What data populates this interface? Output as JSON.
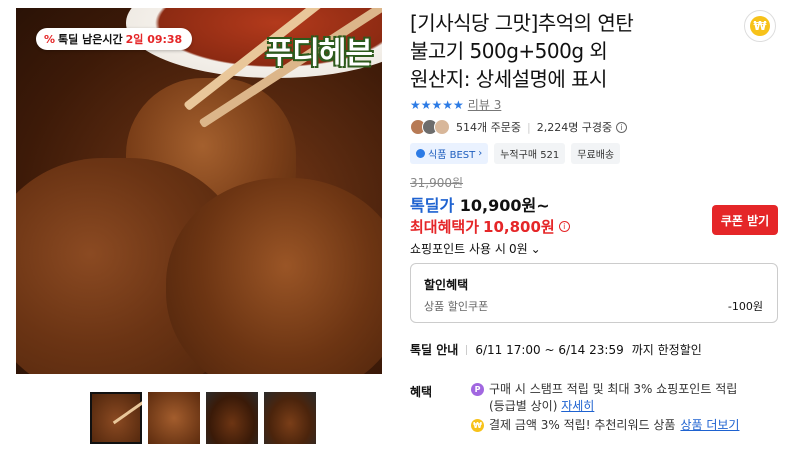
{
  "image": {
    "timer_badge": {
      "icon": "%",
      "label": "톡딜 남은시간",
      "time": "2일 09:38"
    },
    "logo_text": "푸디헤븐"
  },
  "product": {
    "title_line1": "[기사식당 그맛]추억의 연탄",
    "title_line2": "불고기 500g+500g 외",
    "title_line3": "원산지: 상세설명에 표시",
    "review_link": "리뷰 3",
    "orders": "514개 주문중",
    "subscribers": "2,224명 구경중",
    "tags": {
      "best": "식품 BEST",
      "cumulative": "누적구매 521",
      "shipping": "무료배송"
    }
  },
  "price": {
    "original": "31,900원",
    "sale_label": "톡딜가",
    "sale_value": "10,900원~",
    "max_label": "최대혜택가",
    "max_value": "10,800원",
    "coupon_button": "쿠폰 받기",
    "points": "쇼핑포인트 사용 시",
    "points_value": "0원"
  },
  "discount_box": {
    "heading": "할인혜택",
    "row_label": "상품 할인쿠폰",
    "row_amount": "-100원"
  },
  "deal": {
    "label": "톡딜 안내",
    "period": "6/11 17:00 ~ 6/14 23:59",
    "suffix": "까지 한정할인"
  },
  "benefits": {
    "label": "혜택",
    "line1": "구매 시 스탬프 적립 및 최대 3% 쇼핑포인트 적립",
    "line1_sub": "(등급별 상이)",
    "line1_link": "자세히",
    "line2": "결제 금액 3% 적립! 추천리워드 상품",
    "line2_link": "상품 더보기"
  },
  "colors": {
    "accent_red": "#e52628",
    "accent_blue": "#1e62d0",
    "star_blue": "#2c7be5"
  },
  "rating_stars": 4
}
